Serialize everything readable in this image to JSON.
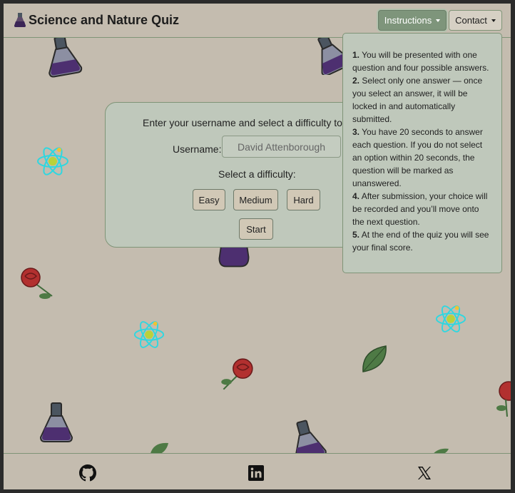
{
  "header": {
    "brand": "Science and Nature Quiz",
    "instructions_label": "Instructions",
    "contact_label": "Contact"
  },
  "instructions": [
    {
      "num": "1.",
      "text": "You will be presented with one question and four possible answers."
    },
    {
      "num": "2.",
      "text": "Select only one answer — once you select an answer, it will be locked in and automatically submitted."
    },
    {
      "num": "3.",
      "text": "You have 20 seconds to answer each question. If you do not select an option within 20 seconds, the question will be marked as unanswered."
    },
    {
      "num": "4.",
      "text": "After submission, your choice will be recorded and you’ll move onto the next question."
    },
    {
      "num": "5.",
      "text": "At the end of the quiz you will see your final score."
    }
  ],
  "setup": {
    "intro": "Enter your username and select a difficulty to",
    "username_label": "Username:",
    "username_placeholder": "David Attenborough",
    "difficulty_label": "Select a difficulty:",
    "easy": "Easy",
    "medium": "Medium",
    "hard": "Hard",
    "start": "Start"
  },
  "footer": {
    "icons": [
      "github-icon",
      "linkedin-icon",
      "x-icon"
    ]
  },
  "colors": {
    "background": "#c4bcaf",
    "card": "#bfc8bb",
    "accent": "#7e957b",
    "button": "#d1c8b6"
  }
}
